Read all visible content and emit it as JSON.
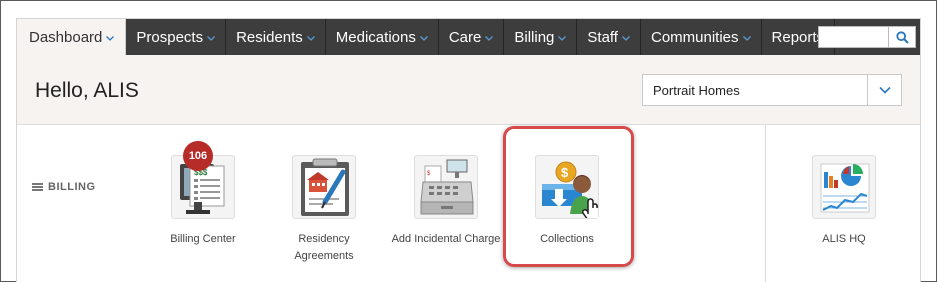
{
  "nav": {
    "items": [
      {
        "label": "Dashboard",
        "dropdown": true,
        "active": true
      },
      {
        "label": "Prospects",
        "dropdown": true
      },
      {
        "label": "Residents",
        "dropdown": true
      },
      {
        "label": "Medications",
        "dropdown": true
      },
      {
        "label": "Care",
        "dropdown": true
      },
      {
        "label": "Billing",
        "dropdown": true
      },
      {
        "label": "Staff",
        "dropdown": true
      },
      {
        "label": "Communities",
        "dropdown": true
      },
      {
        "label": "Reports",
        "dropdown": false
      }
    ],
    "search": {
      "placeholder": "",
      "icon": "search-icon"
    }
  },
  "header": {
    "greeting": "Hello, ALIS",
    "community_select": {
      "value": "Portrait Homes"
    }
  },
  "section": {
    "label": "BILLING",
    "icon": "menu-icon"
  },
  "tiles": [
    {
      "label": "Billing Center",
      "badge": "106",
      "icon": "billing-center-icon"
    },
    {
      "label": "Residency Agreements",
      "icon": "residency-agreements-icon"
    },
    {
      "label": "Add Incidental Charge",
      "icon": "cash-register-icon"
    },
    {
      "label": "Collections",
      "icon": "collections-icon",
      "highlighted": true
    },
    {
      "label": "ALIS HQ",
      "icon": "alis-hq-icon"
    }
  ],
  "colors": {
    "nav_bg": "#3d3d3d",
    "header_bg": "#f6f3f1",
    "accent_blue": "#2a77b9",
    "badge": "#b62c28",
    "highlight": "#d64a4c"
  }
}
